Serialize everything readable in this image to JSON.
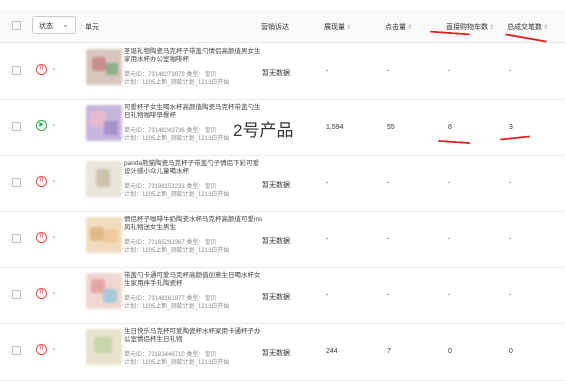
{
  "header": {
    "status_filter": "状态",
    "unit": "单元",
    "marketing": "营销诉达",
    "impressions": "展现量",
    "clicks": "点击量",
    "cart": "直接购物车数",
    "orders": "总成交笔数"
  },
  "overlay_label": "2号产品",
  "colors": {
    "stop": "#e04848",
    "run": "#2aa64e",
    "annotation": "#e02020"
  },
  "rows": [
    {
      "status": "paused",
      "title": "圣诞礼物陶瓷马克杯子带盖勺情侣高颜值男女生家用水杯办公室咖啡杯",
      "meta1": "单元ID：73148273679  类型：宝贝",
      "meta2": "计划：1205上新_测款计划_1213日开始",
      "marketing": "暂无数据",
      "impressions": "-",
      "clicks": "-",
      "cart": "-",
      "orders": "-"
    },
    {
      "status": "running",
      "title": "可爱杯子女生喝水杯高颜值陶瓷马克杯带盖勺生日礼物咖啡早餐杯",
      "meta1": "单元ID：73148243736  类型：宝贝",
      "meta2": "计划：1205上新_测款计划_1213日开始",
      "marketing": "",
      "impressions": "1,594",
      "clicks": "55",
      "cart": "8",
      "orders": "3"
    },
    {
      "status": "paused",
      "title": "panda熊猫陶瓷马克杯子带盖勺子情侣下彩可爱设计感小众儿童喝水杯",
      "meta1": "单元ID：73198152233  类型：宝贝",
      "meta2": "计划：1205上新_测款计划_1213日开始",
      "marketing": "暂无数据",
      "impressions": "-",
      "clicks": "-",
      "cart": "-",
      "orders": "-"
    },
    {
      "status": "paused",
      "title": "情侣杯子咖啡牛奶陶瓷水杯马克杯高颜值可爱ins风礼物送女生男生",
      "meta1": "单元ID：73165293367  类型：宝贝",
      "meta2": "计划：1205上新_测款计划_1213日开始",
      "marketing": "暂无数据",
      "impressions": "-",
      "clicks": "-",
      "cart": "-",
      "orders": "-"
    },
    {
      "status": "paused",
      "title": "带盖勺卡通可爱马克杯高颜值创意生日喝水杯女生家用伴手礼陶瓷杯",
      "meta1": "单元ID：73148161877  类型：宝贝",
      "meta2": "计划：1205上新_测款计划_1213日开始",
      "marketing": "暂无数据",
      "impressions": "-",
      "clicks": "-",
      "cart": "-",
      "orders": "-"
    },
    {
      "status": "paused",
      "title": "生日快乐马克杯可爱陶瓷杯水杯家用卡通杯子办公室情侣杯生日礼物",
      "meta1": "单元ID：73183448710  类型：宝贝",
      "meta2": "计划：1205上新_测款计划_1213日开始",
      "marketing": "暂无数据",
      "impressions": "244",
      "clicks": "7",
      "cart": "0",
      "orders": "0"
    }
  ]
}
